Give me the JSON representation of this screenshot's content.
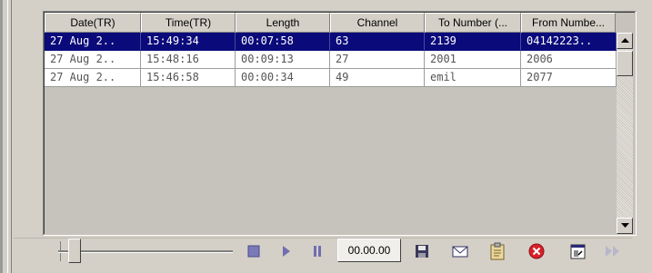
{
  "columns": [
    "Date(TR)",
    "Time(TR)",
    "Length",
    "Channel",
    "To Number (...",
    "From Numbe..."
  ],
  "rows": [
    [
      "27 Aug 2..",
      "15:49:34",
      "00:07:58",
      "63",
      "2139",
      "04142223.."
    ],
    [
      "27 Aug 2..",
      "15:48:16",
      "00:09:13",
      "27",
      "2001",
      "2006"
    ],
    [
      "27 Aug 2..",
      "15:46:58",
      "00:00:34",
      "49",
      "emil",
      "2077"
    ]
  ],
  "selected_row": 0,
  "player": {
    "time": "00.00.00",
    "position": 0
  },
  "colors": {
    "selection": "#0a0a7a",
    "face": "#d4d0c8",
    "close_red": "#d8202a"
  },
  "icons": [
    "stop-icon",
    "play-icon",
    "pause-icon",
    "save-icon",
    "mail-icon",
    "clipboard-icon",
    "close-icon",
    "export-icon",
    "fast-forward-icon"
  ]
}
